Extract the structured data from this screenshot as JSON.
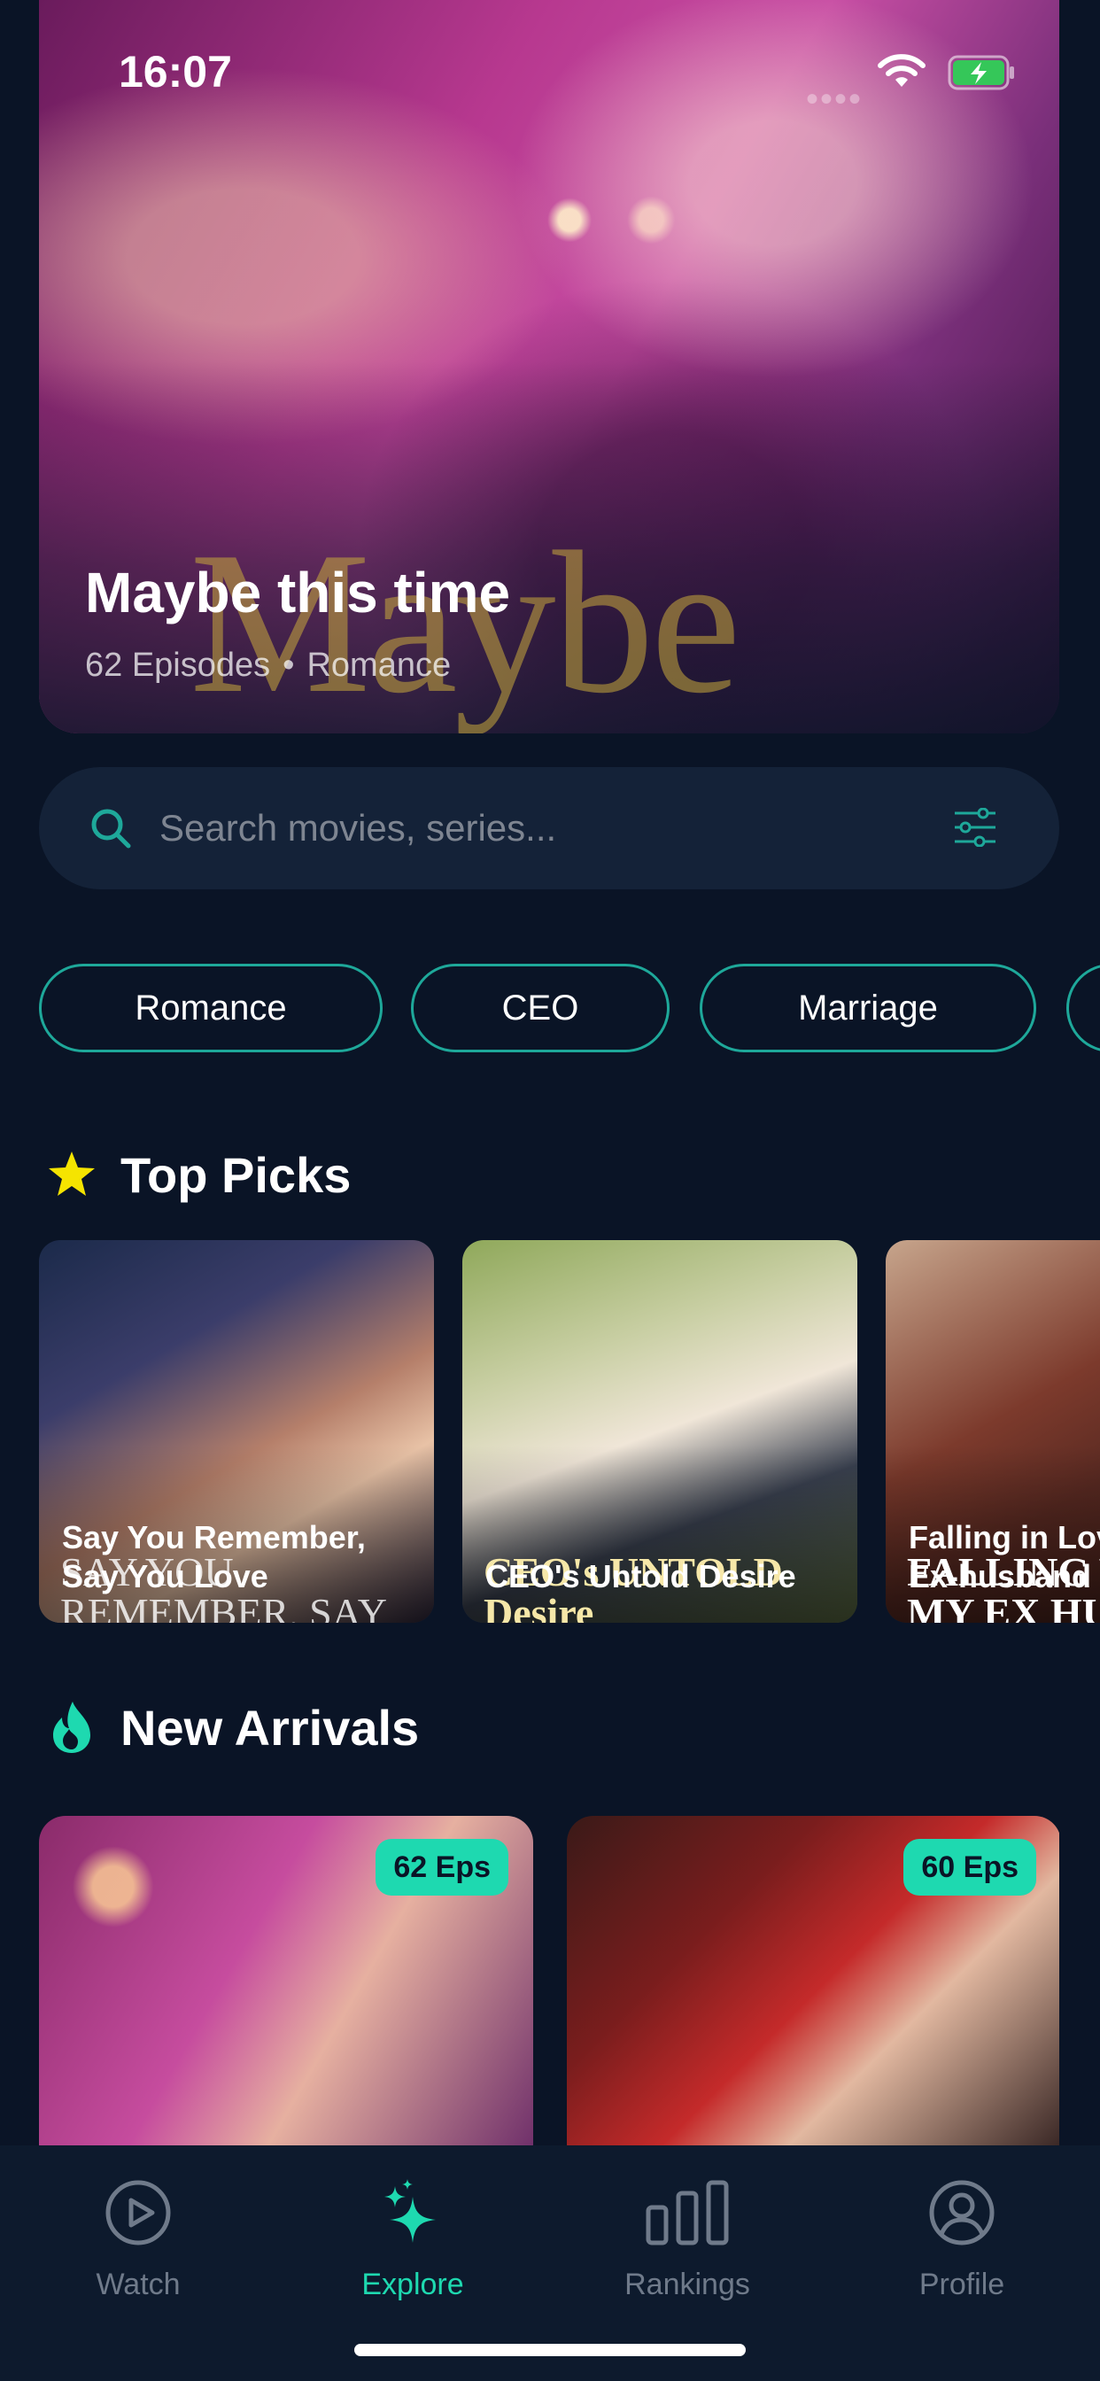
{
  "status_bar": {
    "time": "16:07"
  },
  "hero": {
    "wordmark": "Maybe",
    "title": "Maybe this time",
    "episodes": "62 Episodes",
    "separator": "•",
    "genre": "Romance"
  },
  "search": {
    "placeholder": "Search movies, series..."
  },
  "categories": [
    "Romance",
    "CEO",
    "Marriage"
  ],
  "top_picks": {
    "title": "Top Picks",
    "items": [
      {
        "title": "Say You Remember, Say You Love",
        "art_text": "SAY YOU REMEMBER, SAY YOU LOVE"
      },
      {
        "title": "CEO's Untold Desire",
        "art_text": "CEO's UNTOLD Desire"
      },
      {
        "title": "Falling in Love with My Ex-husband",
        "art_text": "FALLING WITH MY EX HUSBAND"
      }
    ]
  },
  "new_arrivals": {
    "title": "New Arrivals",
    "items": [
      {
        "badge": "62 Eps"
      },
      {
        "badge": "60 Eps"
      }
    ]
  },
  "tab_bar": {
    "tabs": [
      {
        "label": "Watch",
        "icon": "play-circle-icon",
        "active": false
      },
      {
        "label": "Explore",
        "icon": "sparkles-icon",
        "active": true
      },
      {
        "label": "Rankings",
        "icon": "bar-chart-icon",
        "active": false
      },
      {
        "label": "Profile",
        "icon": "person-circle-icon",
        "active": false
      }
    ]
  },
  "colors": {
    "background": "#0a1426",
    "accent": "#1ed9b0",
    "chip_border": "#1ea89a",
    "star": "#f5e400"
  }
}
